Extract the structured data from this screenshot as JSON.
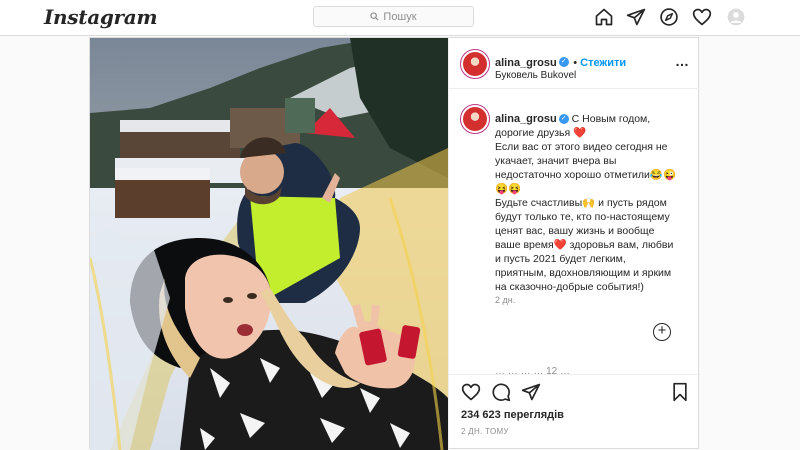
{
  "header": {
    "logo": "Instagram",
    "search_placeholder": "Пошук"
  },
  "post": {
    "username": "alina_grosu",
    "follow_label": "Стежити",
    "location": "Буковель Bukovel",
    "caption_lines": [
      "С Новым годом,",
      "дорогие друзья ❤️",
      "Если вас от этого видео сегодня не",
      "укачает, значит вчера вы",
      "недостаточно хорошо отметили😂😜",
      "😝😝",
      "Будьте счастливы🙌 и пусть рядом",
      "будут только те, кто по-настоящему",
      "ценят вас, вашу жизнь и вообще",
      "ваше время❤️ здоровья вам, любви",
      "и пусть 2021 будет легким,",
      "приятным, вдохновляющим и ярким",
      "на сказочно-добрые события!)"
    ],
    "comment_time": "2 дн.",
    "faded_comment": "…   …  …   …  12  …",
    "views": "234 623 переглядів",
    "posted_ago": "2 ДН. ТОМУ"
  },
  "colors": {
    "accent": "#0095f6",
    "verified": "#3897f0",
    "border": "#dbdbdb",
    "muted": "#8e8e8e"
  },
  "icons": [
    "search-icon",
    "home-icon",
    "direct-icon",
    "explore-icon",
    "heart-icon",
    "profile-icon",
    "more-icon",
    "add-comment-icon",
    "like-icon",
    "comment-icon",
    "share-icon",
    "save-icon"
  ]
}
